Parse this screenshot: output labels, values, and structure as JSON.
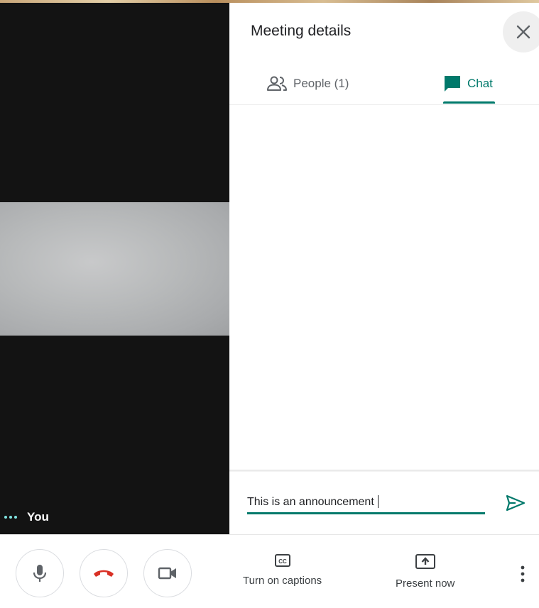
{
  "panel": {
    "title": "Meeting details",
    "tabs": [
      {
        "label": "People (1)",
        "icon": "people-icon",
        "selected": false
      },
      {
        "label": "Chat",
        "icon": "chat-icon",
        "selected": true
      }
    ]
  },
  "video": {
    "self_label": "You"
  },
  "composer": {
    "value": "This is an announcement"
  },
  "toolbar": {
    "captions_label": "Turn on captions",
    "present_label": "Present now"
  },
  "colors": {
    "accent": "#00796b",
    "end_call": "#d93025",
    "video_background": "#131313"
  },
  "icons": [
    "close-icon",
    "people-icon",
    "chat-icon",
    "send-icon",
    "mic-icon",
    "hang-up-icon",
    "camera-icon",
    "captions-icon",
    "present-icon",
    "more-vert-icon",
    "more-options-dots-icon"
  ]
}
